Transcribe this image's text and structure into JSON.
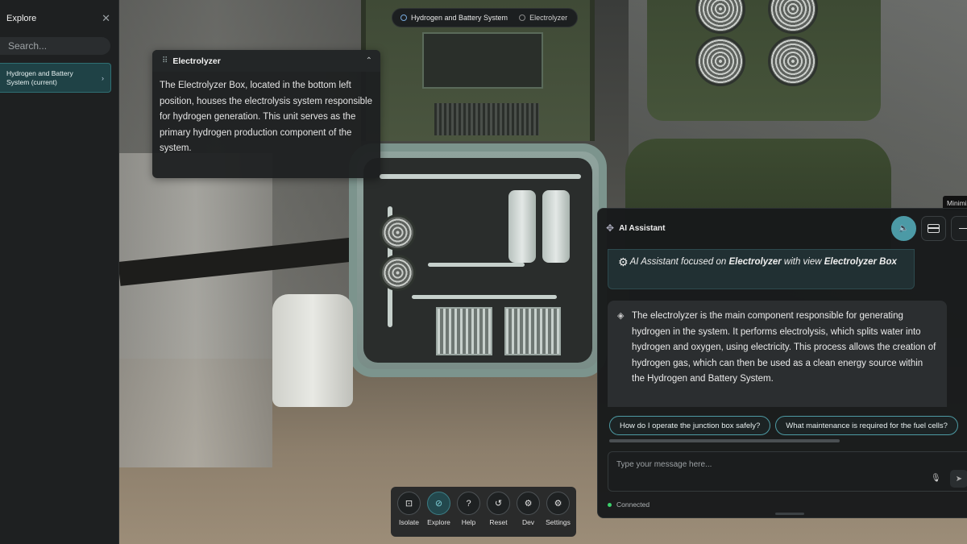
{
  "sidebar": {
    "title": "Explore",
    "search_placeholder": "Search...",
    "items": [
      {
        "label": "Hydrogen and Battery System (current)"
      }
    ]
  },
  "breadcrumb": {
    "items": [
      "Hydrogen and Battery System",
      "Electrolyzer"
    ]
  },
  "info_card": {
    "title": "Electrolyzer",
    "body": "The Electrolyzer Box, located in the bottom left position, houses the electrolysis system responsible for hydrogen generation. This unit serves as the primary hydrogen production component of the system."
  },
  "tooltip": "Minimize",
  "assistant": {
    "title": "AI Assistant",
    "context": {
      "prefix": "AI Assistant focused on ",
      "focus": "Electrolyzer",
      "middle": " with view ",
      "view": "Electrolyzer Box"
    },
    "reply": "The electrolyzer is the main component responsible for generating hydrogen in the system. It performs electrolysis, which splits water into hydrogen and oxygen, using electricity. This process allows the creation of hydrogen gas, which can then be used as a clean energy source within the Hydrogen and Battery System.",
    "suggestions": [
      "How do I operate the junction box safely?",
      "What maintenance is required for the fuel cells?"
    ],
    "input_placeholder": "Type your message here...",
    "status": "Connected"
  },
  "toolbar": {
    "tools": [
      {
        "label": "Isolate",
        "icon": "isolate-icon"
      },
      {
        "label": "Explore",
        "icon": "compass-icon"
      },
      {
        "label": "Help",
        "icon": "help-icon"
      },
      {
        "label": "Reset",
        "icon": "reset-icon"
      },
      {
        "label": "Dev",
        "icon": "gear-icon"
      },
      {
        "label": "Settings",
        "icon": "gear-icon"
      }
    ]
  },
  "colors": {
    "accent": "#4c9aa6",
    "selected_item_bg": "#1f4246",
    "status_connected": "#3bd06b"
  }
}
